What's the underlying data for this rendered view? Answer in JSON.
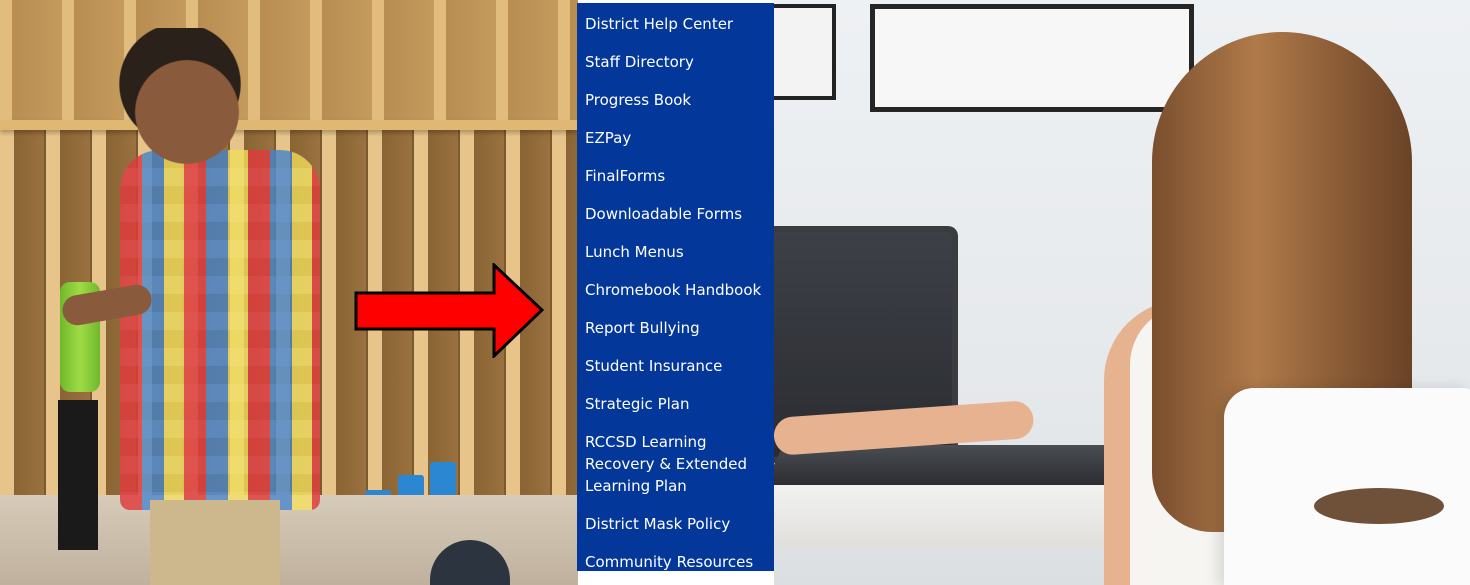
{
  "quick_links": {
    "items": [
      {
        "label": "District Help Center"
      },
      {
        "label": "Staff Directory"
      },
      {
        "label": "Progress Book"
      },
      {
        "label": "EZPay"
      },
      {
        "label": "FinalForms"
      },
      {
        "label": "Downloadable Forms"
      },
      {
        "label": "Lunch Menus"
      },
      {
        "label": "Chromebook Handbook"
      },
      {
        "label": "Report Bullying"
      },
      {
        "label": "Student Insurance"
      },
      {
        "label": "Strategic Plan"
      },
      {
        "label": "RCCSD Learning Recovery & Extended Learning Plan"
      },
      {
        "label": "District Mask Policy"
      },
      {
        "label": "Community Resources"
      }
    ]
  },
  "colors": {
    "menu_background": "#03379a",
    "menu_text": "#ffffff",
    "arrow_fill": "#ff0000",
    "arrow_outline": "#000000"
  },
  "annotation": {
    "icon": "red-arrow-icon",
    "points_to_item": "Report Bullying"
  }
}
